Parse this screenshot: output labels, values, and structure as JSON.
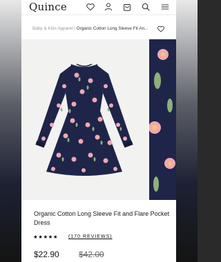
{
  "header": {
    "logo": "Quince",
    "icons": [
      "heart-icon",
      "user-icon",
      "cart-icon",
      "search-icon",
      "menu-icon"
    ]
  },
  "breadcrumb": {
    "parent": "Baby & Kids Apparel",
    "separator": "/",
    "current": "Organic Cotton Long Sleeve Fit An..."
  },
  "product": {
    "title": "Organic Cotton Long Sleeve Fit and Flare Pocket Dress",
    "stars": "★★★★★",
    "rating": 5,
    "reviews": "(170 REVIEWS)",
    "price": "$22.90",
    "original_price": "$42.00"
  },
  "colors": {
    "dress": "#1e2549",
    "flower": "#f2a7b2",
    "leaf": "#8fb07a"
  }
}
